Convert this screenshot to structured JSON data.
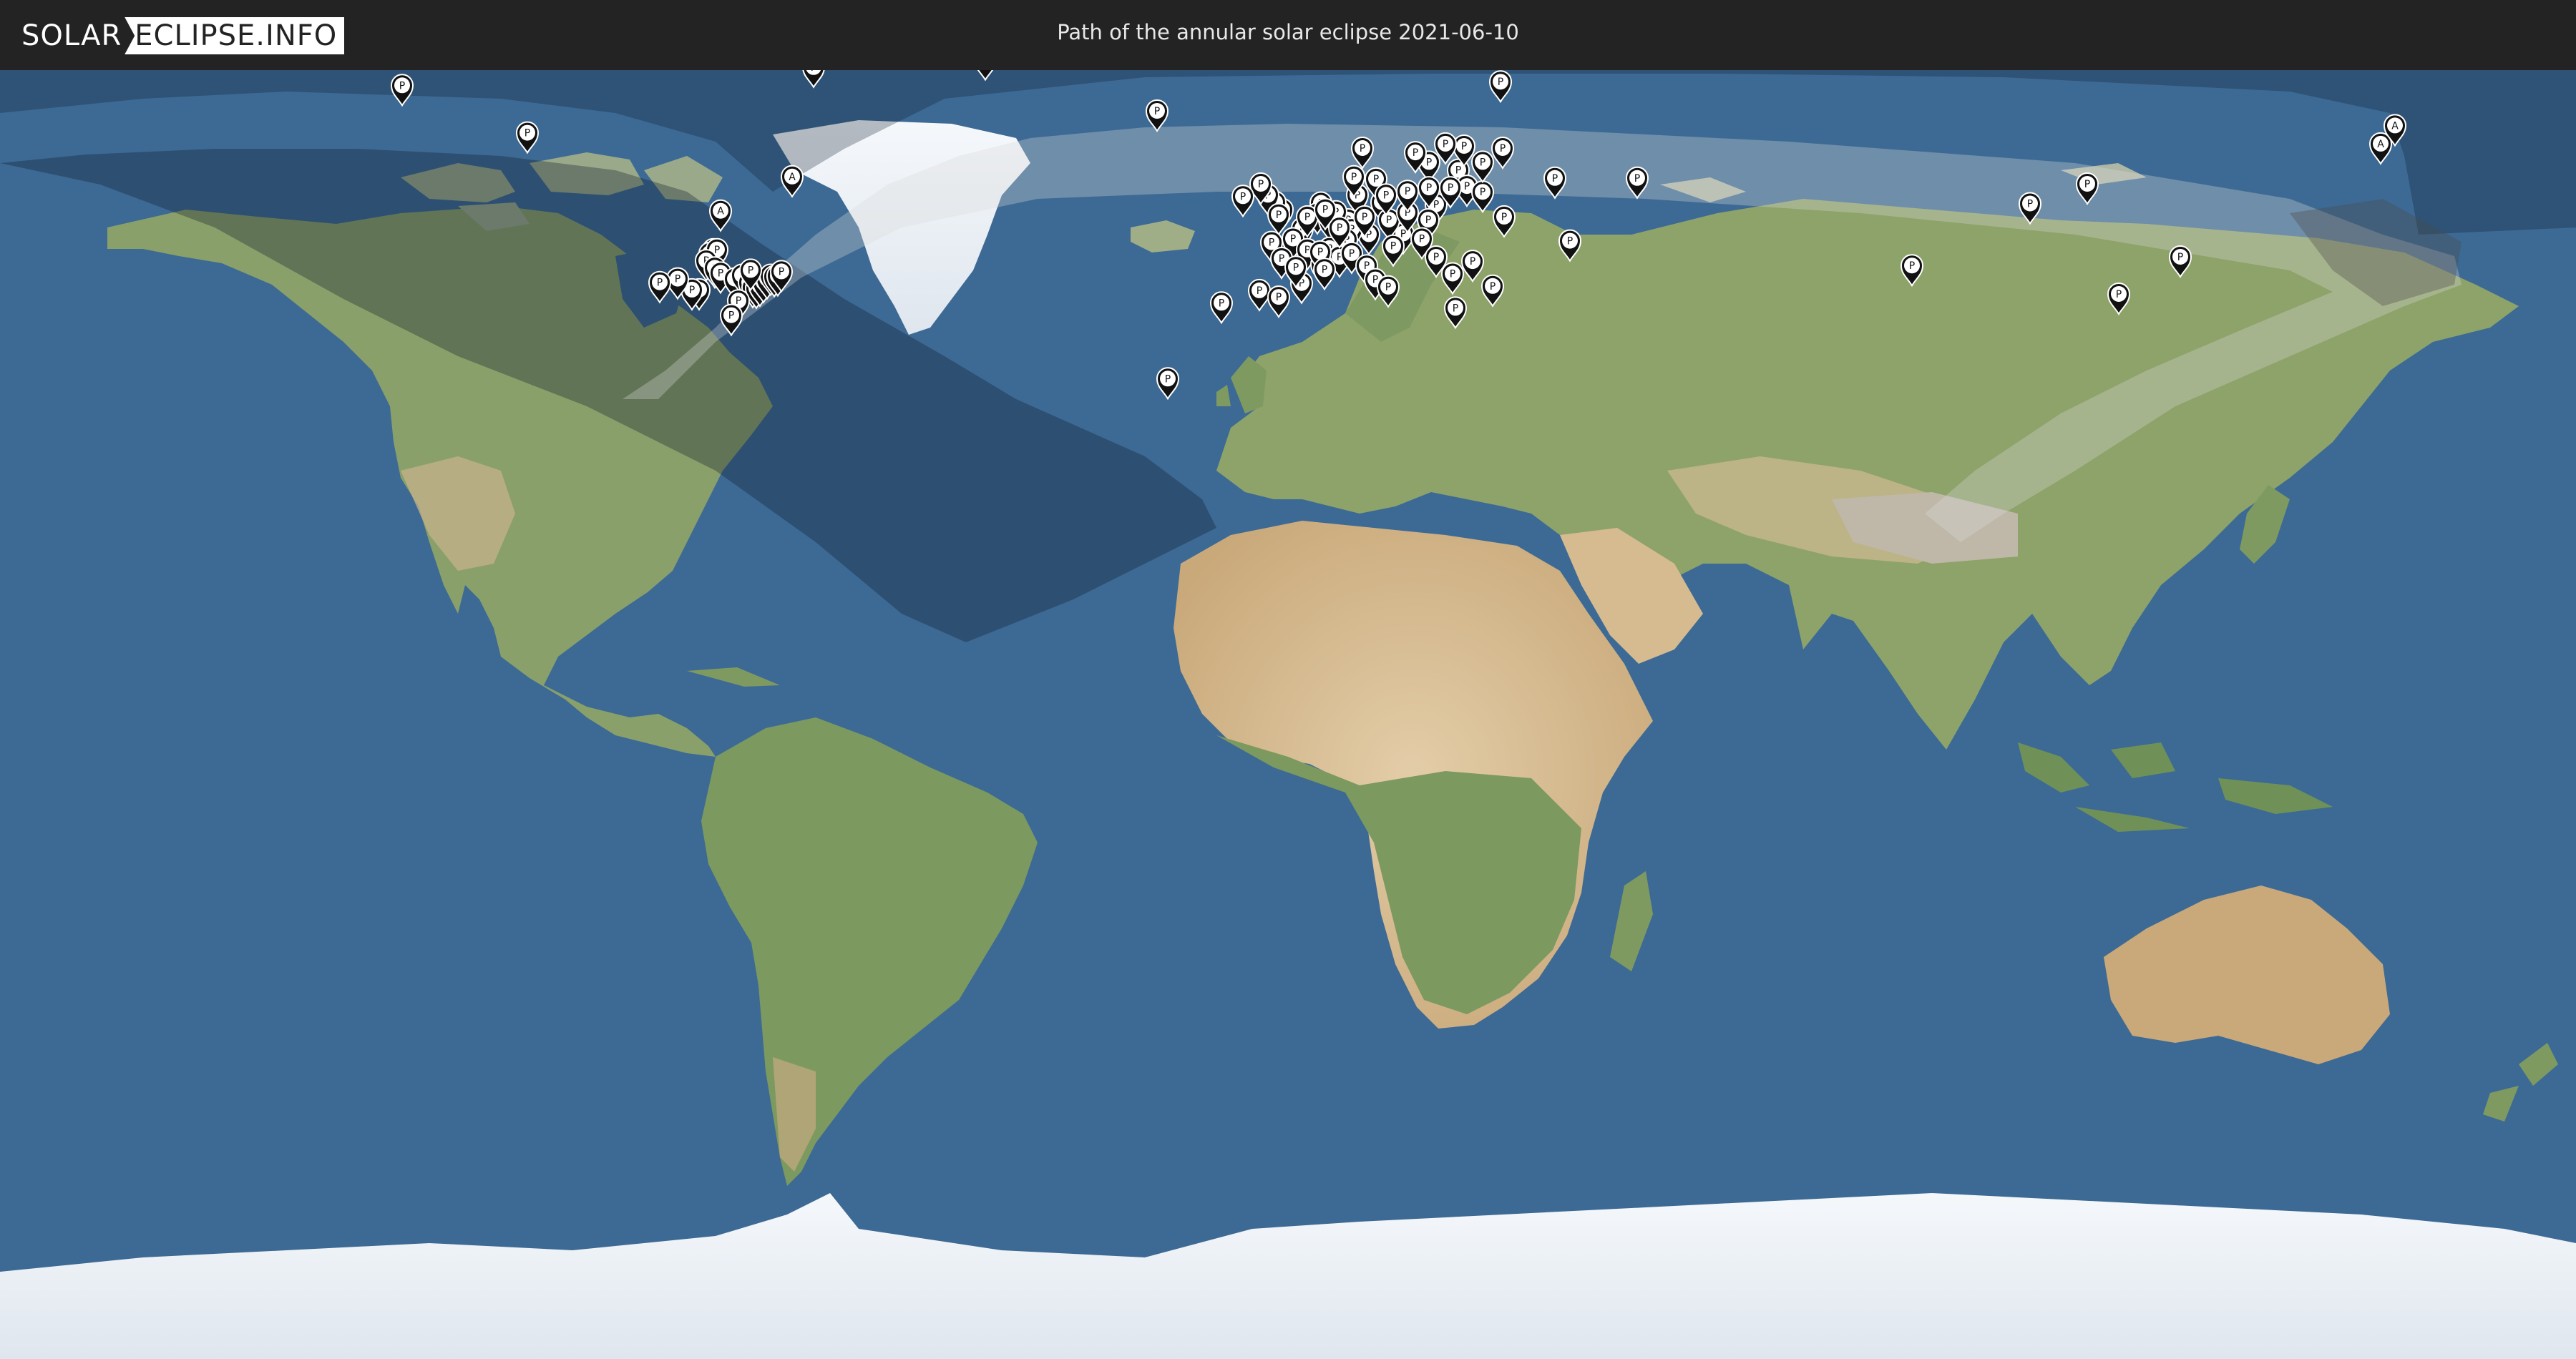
{
  "header": {
    "logo_part1": "SOLAR",
    "logo_part2": "ECLIPSE.INFO",
    "title": "Path of the annular solar eclipse 2021-06-10"
  },
  "colors": {
    "header_bg": "#232323",
    "ocean": "#3d6a94",
    "land": "#8ea36a",
    "desert": "#d7bf94",
    "ice": "#eef2f6",
    "penumbra_shade": "#0b1a2c",
    "annular_path": "#d9d9d9"
  },
  "markers": {
    "partial_label": "P",
    "annular_label": "A",
    "partial": [
      [
        -123.5,
        68.5
      ],
      [
        -106,
        62
      ],
      [
        -66,
        71
      ],
      [
        -42,
        72
      ],
      [
        -18,
        65
      ],
      [
        30,
        69
      ],
      [
        20,
        58
      ],
      [
        -80,
        46
      ],
      [
        -80.5,
        45.5
      ],
      [
        -79.5,
        46
      ],
      [
        -81,
        44.5
      ],
      [
        -79.8,
        43.5
      ],
      [
        -79,
        42.8
      ],
      [
        -77,
        42
      ],
      [
        -76,
        42.5
      ],
      [
        -75,
        41.5
      ],
      [
        -74.5,
        40.8
      ],
      [
        -74,
        40.7
      ],
      [
        -73.5,
        41
      ],
      [
        -73,
        41.5
      ],
      [
        -72.5,
        42
      ],
      [
        -72,
        42.5
      ],
      [
        -71.5,
        42.3
      ],
      [
        -71,
        42.4
      ],
      [
        -70.5,
        43
      ],
      [
        -76.5,
        39
      ],
      [
        -74.8,
        43.2
      ],
      [
        -82,
        40.5
      ],
      [
        -83,
        40.5
      ],
      [
        -85,
        42
      ],
      [
        -87.5,
        41.5
      ],
      [
        -77.5,
        37
      ],
      [
        -16.5,
        28.3
      ],
      [
        -3.7,
        40.4
      ],
      [
        -1,
        39.5
      ],
      [
        2.2,
        41.4
      ],
      [
        -9,
        38.7
      ],
      [
        2.3,
        48.9
      ],
      [
        -0.5,
        51.5
      ],
      [
        -1.5,
        52.5
      ],
      [
        -2.5,
        53.5
      ],
      [
        -3.5,
        55
      ],
      [
        -6,
        53.3
      ],
      [
        -1,
        50.8
      ],
      [
        4.9,
        52.4
      ],
      [
        4.4,
        50.9
      ],
      [
        6.1,
        50
      ],
      [
        8.7,
        50.1
      ],
      [
        7,
        51.2
      ],
      [
        10,
        53.5
      ],
      [
        13.4,
        52.5
      ],
      [
        11.6,
        48.1
      ],
      [
        9.2,
        48.8
      ],
      [
        8.5,
        47.4
      ],
      [
        6.1,
        46.2
      ],
      [
        7.5,
        45
      ],
      [
        9.2,
        45.5
      ],
      [
        11.3,
        43.8
      ],
      [
        12.5,
        41.9
      ],
      [
        14.3,
        40.9
      ],
      [
        16.4,
        48.2
      ],
      [
        14.4,
        50.1
      ],
      [
        17,
        51.1
      ],
      [
        21,
        52.2
      ],
      [
        19.9,
        50.1
      ],
      [
        19,
        47.5
      ],
      [
        21,
        45
      ],
      [
        26.1,
        44.4
      ],
      [
        23.3,
        42.7
      ],
      [
        23.7,
        38
      ],
      [
        28.9,
        41
      ],
      [
        24.1,
        56.9
      ],
      [
        25.3,
        54.7
      ],
      [
        27.5,
        53.9
      ],
      [
        30.5,
        50.5
      ],
      [
        37.6,
        55.8
      ],
      [
        30.3,
        59.9
      ],
      [
        24.9,
        60.2
      ],
      [
        18.1,
        59.3
      ],
      [
        10.7,
        59.9
      ],
      [
        12.6,
        55.7
      ],
      [
        9.5,
        56
      ],
      [
        22.3,
        60.5
      ],
      [
        27.5,
        58
      ],
      [
        39.7,
        47.2
      ],
      [
        49.1,
        55.8
      ],
      [
        87.5,
        43.8
      ],
      [
        104,
        52.3
      ],
      [
        116.4,
        39.9
      ],
      [
        112,
        55
      ],
      [
        125,
        45
      ],
      [
        1,
        47.5
      ],
      [
        3,
        46
      ],
      [
        5,
        44
      ],
      [
        -2,
        47
      ],
      [
        -0.6,
        44.8
      ],
      [
        1.4,
        43.6
      ],
      [
        4.8,
        45.7
      ],
      [
        5.4,
        43.3
      ],
      [
        15,
        46.5
      ],
      [
        17,
        54
      ],
      [
        20,
        54.5
      ],
      [
        23,
        54.5
      ],
      [
        14,
        53.5
      ],
      [
        11,
        50.5
      ],
      [
        7.5,
        49
      ],
      [
        3,
        50.5
      ],
      [
        5.5,
        51.5
      ]
    ],
    "annular": [
      [
        -79,
        51.3
      ],
      [
        -69,
        56
      ],
      [
        153,
        60.5
      ],
      [
        155,
        63
      ]
    ]
  },
  "eclipse_paths": {
    "penumbra_outline": [
      [
        -180,
        74
      ],
      [
        -150,
        75
      ],
      [
        -120,
        76
      ],
      [
        -95,
        78
      ],
      [
        -75,
        78
      ],
      [
        -60,
        78
      ],
      [
        -50,
        78
      ],
      [
        -38,
        79
      ],
      [
        -20,
        80
      ],
      [
        0,
        81
      ],
      [
        30,
        81
      ],
      [
        60,
        81
      ],
      [
        90,
        80
      ],
      [
        120,
        80
      ],
      [
        150,
        80
      ],
      [
        172,
        78
      ],
      [
        180,
        76
      ],
      [
        180,
        90
      ],
      [
        -180,
        90
      ]
    ]
  }
}
